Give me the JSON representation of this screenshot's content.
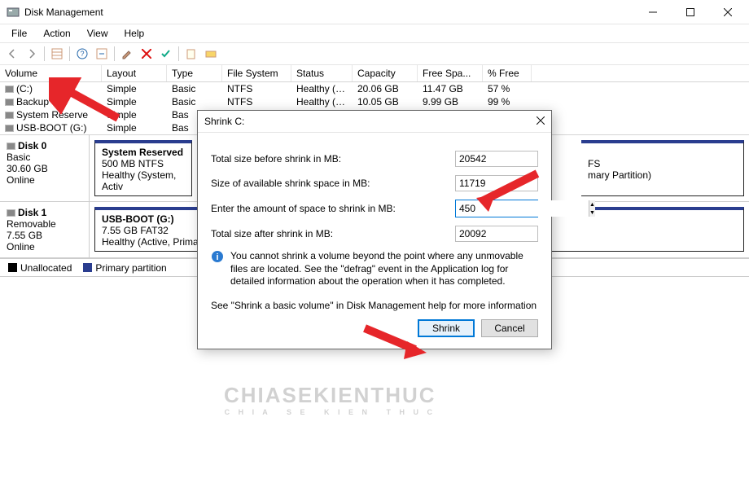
{
  "window": {
    "title": "Disk Management"
  },
  "menu": {
    "file": "File",
    "action": "Action",
    "view": "View",
    "help": "Help"
  },
  "columns": {
    "volume": "Volume",
    "layout": "Layout",
    "type": "Type",
    "fs": "File System",
    "status": "Status",
    "capacity": "Capacity",
    "free": "Free Spa...",
    "pct": "% Free"
  },
  "volumes": [
    {
      "name": "(C:)",
      "layout": "Simple",
      "type": "Basic",
      "fs": "NTFS",
      "status": "Healthy (B...",
      "cap": "20.06 GB",
      "free": "11.47 GB",
      "pct": "57 %"
    },
    {
      "name": "Backup",
      "layout": "Simple",
      "type": "Basic",
      "fs": "NTFS",
      "status": "Healthy (P...",
      "cap": "10.05 GB",
      "free": "9.99 GB",
      "pct": "99 %"
    },
    {
      "name": "System Reserve",
      "layout": "Simple",
      "type": "Bas",
      "fs": "",
      "status": "",
      "cap": "",
      "free": "",
      "pct": ""
    },
    {
      "name": "USB-BOOT (G:)",
      "layout": "Simple",
      "type": "Bas",
      "fs": "",
      "status": "",
      "cap": "",
      "free": "",
      "pct": ""
    }
  ],
  "dialog": {
    "title": "Shrink C:",
    "fields": {
      "total_before_lbl": "Total size before shrink in MB:",
      "total_before": "20542",
      "avail_lbl": "Size of available shrink space in MB:",
      "avail": "11719",
      "amount_lbl": "Enter the amount of space to shrink in MB:",
      "amount": "450",
      "total_after_lbl": "Total size after shrink in MB:",
      "total_after": "20092"
    },
    "info": "You cannot shrink a volume beyond the point where any unmovable files are located. See the \"defrag\" event in the Application log for detailed information about the operation when it has completed.",
    "see": "See \"Shrink a basic volume\" in Disk Management help for more information",
    "shrink_btn": "Shrink",
    "cancel_btn": "Cancel"
  },
  "disks": [
    {
      "name": "Disk 0",
      "type": "Basic",
      "size": "30.60 GB",
      "status": "Online",
      "part_title": "System Reserved",
      "part_sub": "500 MB NTFS",
      "part_health": "Healthy (System, Activ",
      "tail_fs": "FS",
      "tail_health": "mary Partition)"
    },
    {
      "name": "Disk 1",
      "type": "Removable",
      "size": "7.55 GB",
      "status": "Online",
      "part_title": "USB-BOOT  (G:)",
      "part_sub": "7.55 GB FAT32",
      "part_health": "Healthy (Active, Primary Partition)"
    }
  ],
  "legend": {
    "unalloc": "Unallocated",
    "primary": "Primary partition"
  },
  "colors": {
    "unalloc": "#000000",
    "primary": "#2a3d8f"
  }
}
